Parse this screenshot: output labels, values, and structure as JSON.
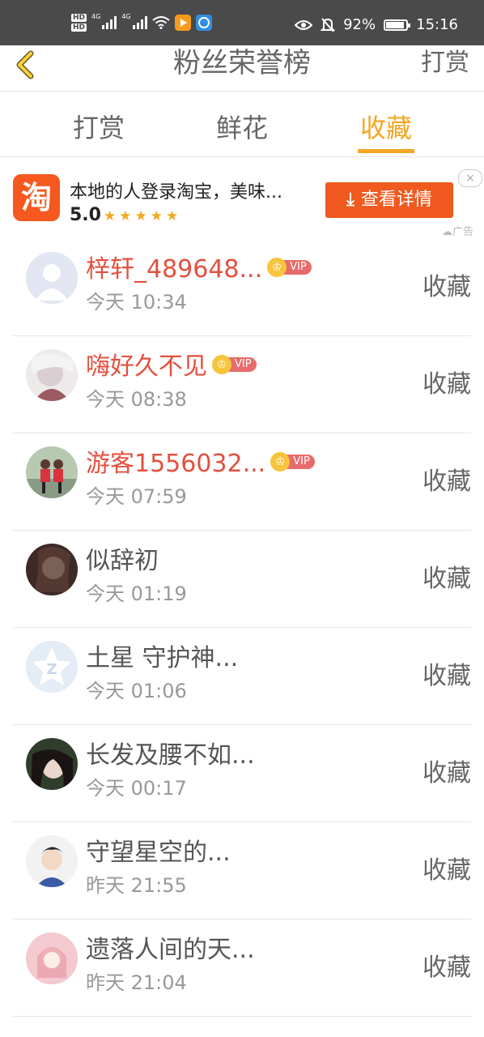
{
  "status_bar": {
    "net1": "4G",
    "net2": "4G",
    "battery_percent": "92%",
    "time": "15:16",
    "battery_level": 0.92
  },
  "header": {
    "title": "粉丝荣誉榜",
    "right_action": "打赏"
  },
  "tabs": [
    {
      "label": "打赏",
      "active": false
    },
    {
      "label": "鲜花",
      "active": false
    },
    {
      "label": "收藏",
      "active": true
    }
  ],
  "ad": {
    "logo_char": "淘",
    "title": "本地的人登录淘宝，美味...",
    "rating": "5.0",
    "stars": "★★★★★",
    "button": "查看详情",
    "close": "×",
    "tag": "广告"
  },
  "fans": [
    {
      "name": "梓轩_489648...",
      "vip": true,
      "vip_label": "VIP",
      "time": "今天 10:34",
      "action": "收藏"
    },
    {
      "name": "嗨好久不见",
      "vip": true,
      "vip_label": "VIP",
      "time": "今天 08:38",
      "action": "收藏"
    },
    {
      "name": "游客1556032...",
      "vip": true,
      "vip_label": "VIP",
      "time": "今天 07:59",
      "action": "收藏"
    },
    {
      "name": "似辞初",
      "vip": false,
      "time": "今天 01:19",
      "action": "收藏"
    },
    {
      "name": "土星 守护神...",
      "vip": false,
      "time": "今天 01:06",
      "action": "收藏"
    },
    {
      "name": "长发及腰不如...",
      "vip": false,
      "time": "今天 00:17",
      "action": "收藏"
    },
    {
      "name": "守望星空的...",
      "vip": false,
      "time": "昨天 21:55",
      "action": "收藏"
    },
    {
      "name": "遗落人间的天...",
      "vip": false,
      "time": "昨天 21:04",
      "action": "收藏"
    }
  ],
  "colors": {
    "accent": "#f5a623",
    "vip_name": "#e3503f",
    "ad_button": "#f05a1f",
    "status_bar": "#4a4a4a"
  }
}
